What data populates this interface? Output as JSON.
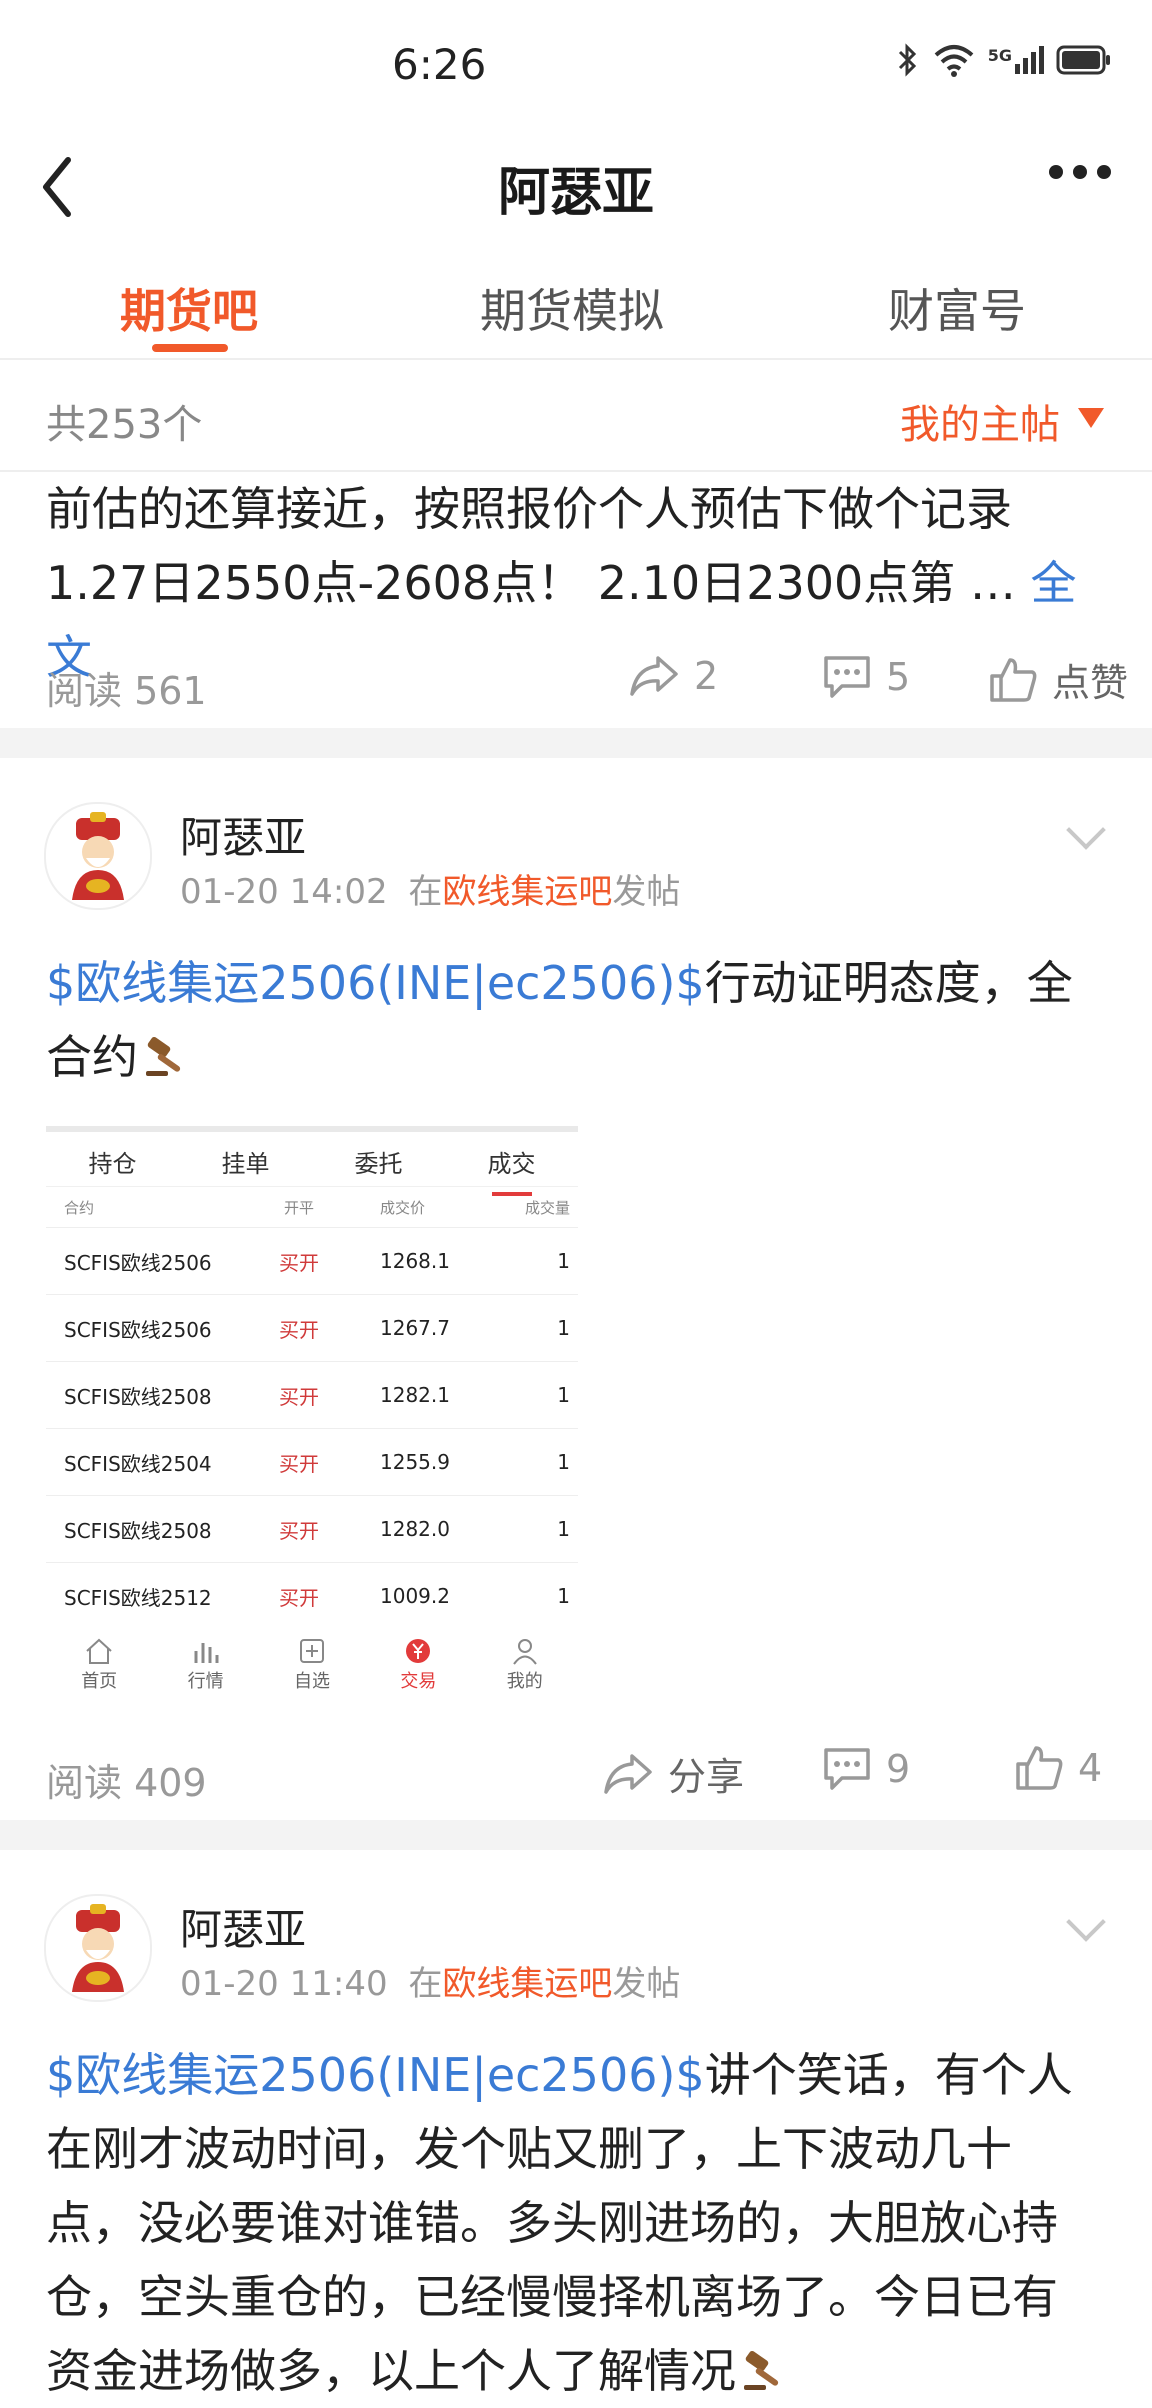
{
  "status_bar": {
    "time": "6:26",
    "icons": [
      "bluetooth-icon",
      "wifi-icon",
      "5g-signal-icon",
      "battery-icon"
    ],
    "network": "5G"
  },
  "header": {
    "title": "阿瑟亚",
    "back_icon": "chevron-left-icon",
    "more_icon": "more-dots-icon"
  },
  "tabs": [
    {
      "label": "期货吧",
      "active": true
    },
    {
      "label": "期货模拟",
      "active": false
    },
    {
      "label": "财富号",
      "active": false
    }
  ],
  "filter": {
    "count": "共253个",
    "dropdown": "我的主帖"
  },
  "colors": {
    "accent": "#f1592a",
    "link": "#3a7bd5",
    "muted": "#999999"
  },
  "posts": [
    {
      "text_line1": "前估的还算接近，按照报价个人预估下做个记录",
      "text_line2": "1.27日2550点-2608点！ 2.10日2300点第 …",
      "full_text_link": "全文",
      "reads": "阅读 561",
      "shares": "2",
      "comments": "5",
      "likes": "点赞"
    },
    {
      "author": "阿瑟亚",
      "time": "01-20 14:02",
      "in_label": "在",
      "bar": "欧线集运吧",
      "post_label": "发帖",
      "stock_tag": "$欧线集运2506(INE|ec2506)$",
      "text_line1_rest": "行动证明态度，全",
      "text_line2": "合约",
      "image": {
        "tabs": [
          "持仓",
          "挂单",
          "委托",
          "成交"
        ],
        "active_tab": "成交",
        "columns": [
          "合约",
          "开平",
          "成交价",
          "成交量"
        ],
        "rows": [
          {
            "contract": "SCFIS欧线2506",
            "action": "买开",
            "price": "1268.1",
            "qty": "1"
          },
          {
            "contract": "SCFIS欧线2506",
            "action": "买开",
            "price": "1267.7",
            "qty": "1"
          },
          {
            "contract": "SCFIS欧线2508",
            "action": "买开",
            "price": "1282.1",
            "qty": "1"
          },
          {
            "contract": "SCFIS欧线2504",
            "action": "买开",
            "price": "1255.9",
            "qty": "1"
          },
          {
            "contract": "SCFIS欧线2508",
            "action": "买开",
            "price": "1282.0",
            "qty": "1"
          },
          {
            "contract": "SCFIS欧线2512",
            "action": "买开",
            "price": "1009.2",
            "qty": "1"
          }
        ],
        "nav": [
          "首页",
          "行情",
          "自选",
          "交易",
          "我的"
        ],
        "nav_active": "交易"
      },
      "reads": "阅读 409",
      "shares": "分享",
      "comments": "9",
      "likes": "4"
    },
    {
      "author": "阿瑟亚",
      "time": "01-20 11:40",
      "in_label": "在",
      "bar": "欧线集运吧",
      "post_label": "发帖",
      "stock_tag": "$欧线集运2506(INE|ec2506)$",
      "text_line1_rest": "讲个笑话，有个人",
      "text_line2": "在刚才波动时间，发个贴又删了，上下波动几十",
      "text_line3": "点，没必要谁对谁错。多头刚进场的，大胆放心持",
      "text_line4": "仓，空头重仓的，已经慢慢择机离场了。今日已有",
      "text_line5": "资金进场做多，以上个人了解情况"
    }
  ]
}
